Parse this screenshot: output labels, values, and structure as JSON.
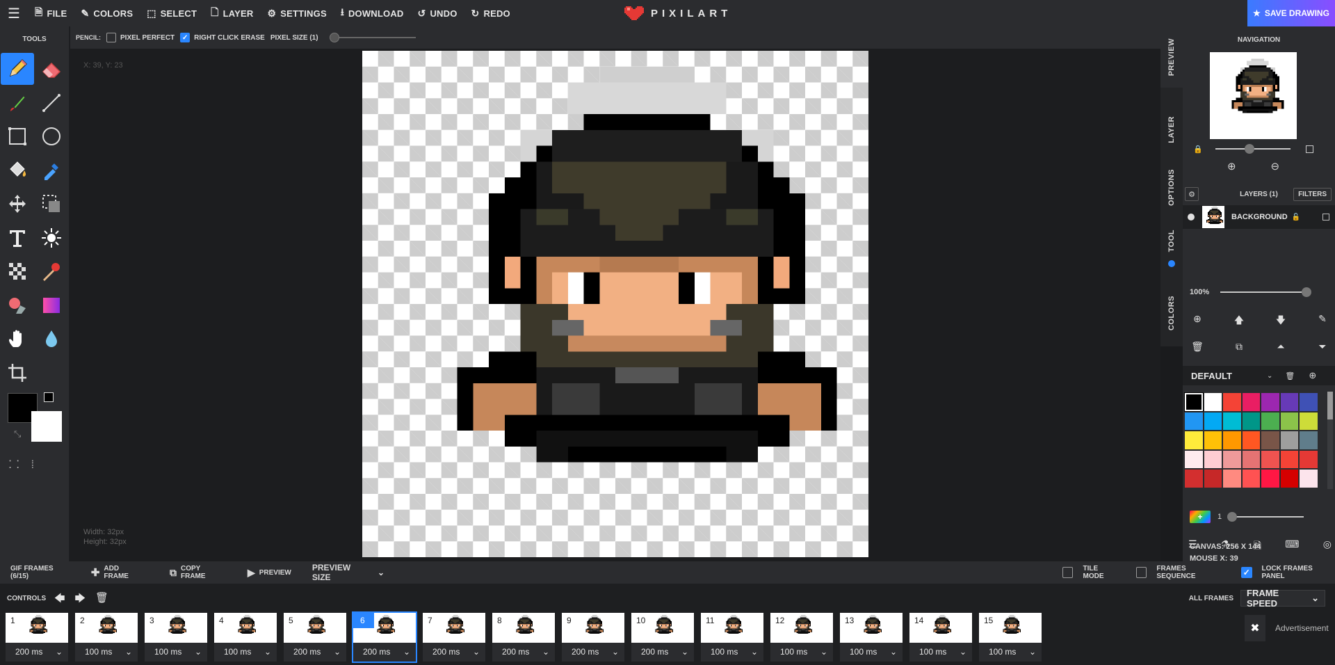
{
  "topbar": {
    "menu_icon": "hamburger-icon",
    "items": [
      {
        "label": "FILE",
        "icon": "file-icon"
      },
      {
        "label": "COLORS",
        "icon": "brush-icon"
      },
      {
        "label": "SELECT",
        "icon": "select-icon"
      },
      {
        "label": "LAYER",
        "icon": "layer-icon"
      },
      {
        "label": "SETTINGS",
        "icon": "gears-icon"
      },
      {
        "label": "DOWNLOAD",
        "icon": "download-icon"
      },
      {
        "label": "UNDO",
        "icon": "undo-icon"
      },
      {
        "label": "REDO",
        "icon": "redo-icon"
      }
    ],
    "brand": "PIXILART",
    "save_label": "SAVE DRAWING"
  },
  "tools": {
    "title": "TOOLS",
    "list": [
      "pencil",
      "eraser",
      "brush",
      "line",
      "rectangle",
      "ellipse",
      "paint-bucket",
      "eyedropper",
      "move",
      "select",
      "text",
      "lighten",
      "dither",
      "stamp",
      "shape-fill",
      "gradient",
      "hand",
      "drop",
      "crop"
    ]
  },
  "options": {
    "tool_label": "PENCIL:",
    "pixel_perfect": "PIXEL PERFECT",
    "right_click_erase": "RIGHT CLICK ERASE",
    "pixel_size": "PIXEL SIZE (1)"
  },
  "workspace": {
    "cursor_coords": "X: 39, Y: 23",
    "width": "Width: 32px",
    "height": "Height: 32px"
  },
  "side_tabs": [
    "PREVIEW",
    "LAYER",
    "OPTIONS",
    "TOOL",
    "COLORS"
  ],
  "right": {
    "navigation_title": "NAVIGATION",
    "layers_title": "LAYERS (1)",
    "filters": "FILTERS",
    "layer_name": "BACKGROUND",
    "opacity": "100%",
    "palette_name": "DEFAULT",
    "brush_size": "1",
    "canvas_info": "CANVAS: 256 X 144",
    "mouse_info": "MOUSE X: 39"
  },
  "palette": [
    "#000000",
    "#ffffff",
    "#f44336",
    "#e91e63",
    "#9c27b0",
    "#673ab7",
    "#3f51b5",
    "#2196f3",
    "#03a9f4",
    "#00bcd4",
    "#009688",
    "#4caf50",
    "#8bc34a",
    "#cddc39",
    "#ffeb3b",
    "#ffc107",
    "#ff9800",
    "#ff5722",
    "#795548",
    "#9e9e9e",
    "#607d8b",
    "#ffebee",
    "#ffcdd2",
    "#ef9a9a",
    "#e57373",
    "#ef5350",
    "#f44336",
    "#e53935",
    "#d32f2f",
    "#c62828",
    "#ff8a80",
    "#ff5252",
    "#ff1744",
    "#d50000",
    "#fce4ec"
  ],
  "framesbar": {
    "gif_frames": "GIF FRAMES (6/15)",
    "add_frame": "ADD FRAME",
    "copy_frame": "COPY FRAME",
    "preview": "PREVIEW",
    "preview_size": "PREVIEW SIZE",
    "tile_mode": "TILE MODE",
    "frames_sequence": "FRAMES SEQUENCE",
    "lock_frames": "LOCK FRAMES PANEL"
  },
  "controls": {
    "label": "CONTROLS",
    "all_frames": "ALL FRAMES",
    "frame_speed": "FRAME SPEED",
    "advertisement": "Advertisement",
    "selected_frame": 6,
    "frames": [
      {
        "num": "1",
        "speed": "200 ms"
      },
      {
        "num": "2",
        "speed": "100 ms"
      },
      {
        "num": "3",
        "speed": "100 ms"
      },
      {
        "num": "4",
        "speed": "100 ms"
      },
      {
        "num": "5",
        "speed": "200 ms"
      },
      {
        "num": "6",
        "speed": "200 ms"
      },
      {
        "num": "7",
        "speed": "200 ms"
      },
      {
        "num": "8",
        "speed": "200 ms"
      },
      {
        "num": "9",
        "speed": "200 ms"
      },
      {
        "num": "10",
        "speed": "200 ms"
      },
      {
        "num": "11",
        "speed": "100 ms"
      },
      {
        "num": "12",
        "speed": "100 ms"
      },
      {
        "num": "13",
        "speed": "100 ms"
      },
      {
        "num": "14",
        "speed": "100 ms"
      },
      {
        "num": "15",
        "speed": "100 ms"
      }
    ]
  }
}
